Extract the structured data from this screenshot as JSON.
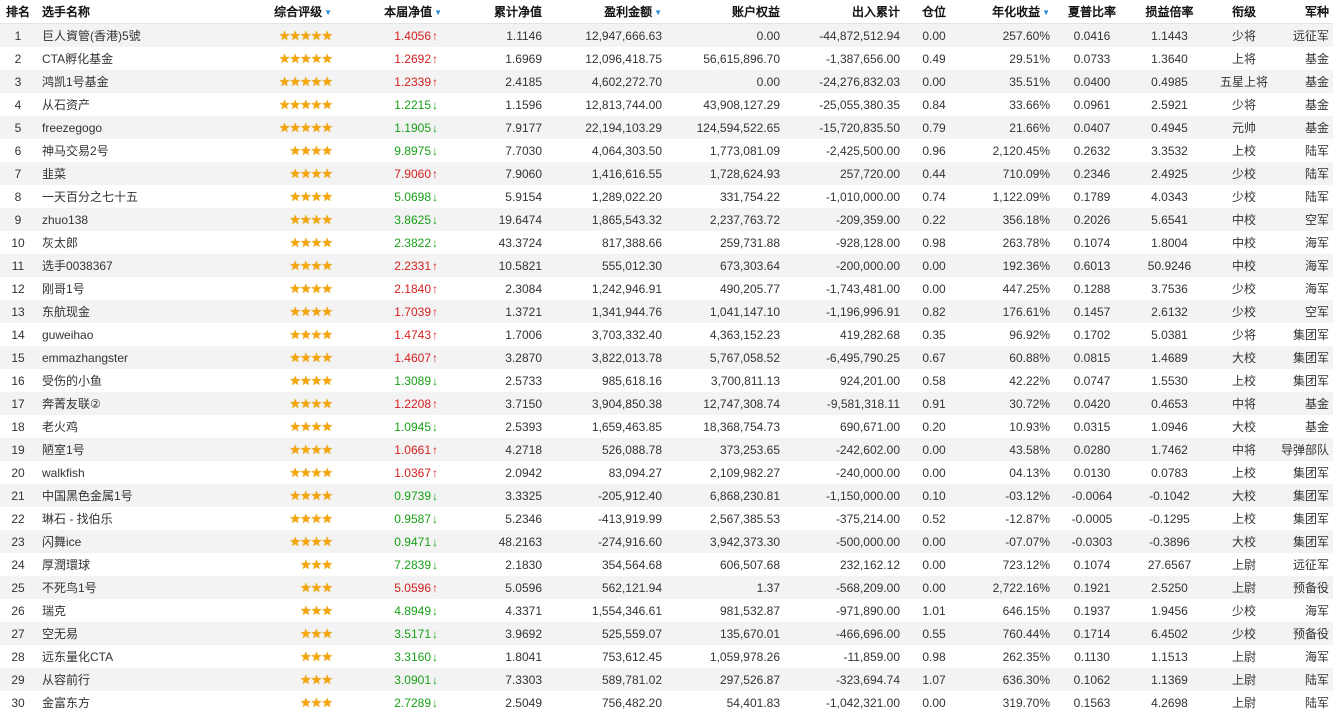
{
  "columns": {
    "rank": "排名",
    "name": "选手名称",
    "rating": "综合评级",
    "nav": "本届净值",
    "cum_nav": "累计净值",
    "profit": "盈利金额",
    "equity": "账户权益",
    "flow": "出入累计",
    "position": "仓位",
    "annual": "年化收益",
    "sharpe": "夏普比率",
    "pl_ratio": "损益倍率",
    "title": "衔级",
    "branch": "军种"
  },
  "sort_indicator": "▼",
  "rows": [
    {
      "rank": "1",
      "name": "巨人資管(香港)5號",
      "stars": "★★★★★",
      "nav": "1.4056",
      "trend": "up",
      "cum_nav": "1.1146",
      "profit": "12,947,666.63",
      "equity": "0.00",
      "flow": "-44,872,512.94",
      "position": "0.00",
      "annual": "257.60%",
      "sharpe": "0.0416",
      "pl_ratio": "1.1443",
      "title": "少将",
      "branch": "远征军"
    },
    {
      "rank": "2",
      "name": "CTA孵化基金",
      "stars": "★★★★★",
      "nav": "1.2692",
      "trend": "up",
      "cum_nav": "1.6969",
      "profit": "12,096,418.75",
      "equity": "56,615,896.70",
      "flow": "-1,387,656.00",
      "position": "0.49",
      "annual": "29.51%",
      "sharpe": "0.0733",
      "pl_ratio": "1.3640",
      "title": "上将",
      "branch": "基金"
    },
    {
      "rank": "3",
      "name": "鸿凯1号基金",
      "stars": "★★★★★",
      "nav": "1.2339",
      "trend": "up",
      "cum_nav": "2.4185",
      "profit": "4,602,272.70",
      "equity": "0.00",
      "flow": "-24,276,832.03",
      "position": "0.00",
      "annual": "35.51%",
      "sharpe": "0.0400",
      "pl_ratio": "0.4985",
      "title": "五星上将",
      "branch": "基金"
    },
    {
      "rank": "4",
      "name": "从石资产",
      "stars": "★★★★★",
      "nav": "1.2215",
      "trend": "down",
      "cum_nav": "1.1596",
      "profit": "12,813,744.00",
      "equity": "43,908,127.29",
      "flow": "-25,055,380.35",
      "position": "0.84",
      "annual": "33.66%",
      "sharpe": "0.0961",
      "pl_ratio": "2.5921",
      "title": "少将",
      "branch": "基金"
    },
    {
      "rank": "5",
      "name": "freezegogo",
      "stars": "★★★★★",
      "nav": "1.1905",
      "trend": "down",
      "cum_nav": "7.9177",
      "profit": "22,194,103.29",
      "equity": "124,594,522.65",
      "flow": "-15,720,835.50",
      "position": "0.79",
      "annual": "21.66%",
      "sharpe": "0.0407",
      "pl_ratio": "0.4945",
      "title": "元帅",
      "branch": "基金"
    },
    {
      "rank": "6",
      "name": "神马交易2号",
      "stars": "★★★★",
      "nav": "9.8975",
      "trend": "down",
      "cum_nav": "7.7030",
      "profit": "4,064,303.50",
      "equity": "1,773,081.09",
      "flow": "-2,425,500.00",
      "position": "0.96",
      "annual": "2,120.45%",
      "sharpe": "0.2632",
      "pl_ratio": "3.3532",
      "title": "上校",
      "branch": "陆军"
    },
    {
      "rank": "7",
      "name": "韭菜",
      "stars": "★★★★",
      "nav": "7.9060",
      "trend": "up",
      "cum_nav": "7.9060",
      "profit": "1,416,616.55",
      "equity": "1,728,624.93",
      "flow": "257,720.00",
      "position": "0.44",
      "annual": "710.09%",
      "sharpe": "0.2346",
      "pl_ratio": "2.4925",
      "title": "少校",
      "branch": "陆军"
    },
    {
      "rank": "8",
      "name": "一天百分之七十五",
      "stars": "★★★★",
      "nav": "5.0698",
      "trend": "down",
      "cum_nav": "5.9154",
      "profit": "1,289,022.20",
      "equity": "331,754.22",
      "flow": "-1,010,000.00",
      "position": "0.74",
      "annual": "1,122.09%",
      "sharpe": "0.1789",
      "pl_ratio": "4.0343",
      "title": "少校",
      "branch": "陆军"
    },
    {
      "rank": "9",
      "name": "zhuo138",
      "stars": "★★★★",
      "nav": "3.8625",
      "trend": "down",
      "cum_nav": "19.6474",
      "profit": "1,865,543.32",
      "equity": "2,237,763.72",
      "flow": "-209,359.00",
      "position": "0.22",
      "annual": "356.18%",
      "sharpe": "0.2026",
      "pl_ratio": "5.6541",
      "title": "中校",
      "branch": "空军"
    },
    {
      "rank": "10",
      "name": "灰太郎",
      "stars": "★★★★",
      "nav": "2.3822",
      "trend": "down",
      "cum_nav": "43.3724",
      "profit": "817,388.66",
      "equity": "259,731.88",
      "flow": "-928,128.00",
      "position": "0.98",
      "annual": "263.78%",
      "sharpe": "0.1074",
      "pl_ratio": "1.8004",
      "title": "中校",
      "branch": "海军"
    },
    {
      "rank": "11",
      "name": "选手0038367",
      "stars": "★★★★",
      "nav": "2.2331",
      "trend": "up",
      "cum_nav": "10.5821",
      "profit": "555,012.30",
      "equity": "673,303.64",
      "flow": "-200,000.00",
      "position": "0.00",
      "annual": "192.36%",
      "sharpe": "0.6013",
      "pl_ratio": "50.9246",
      "title": "中校",
      "branch": "海军"
    },
    {
      "rank": "12",
      "name": "刚哥1号",
      "stars": "★★★★",
      "nav": "2.1840",
      "trend": "up",
      "cum_nav": "2.3084",
      "profit": "1,242,946.91",
      "equity": "490,205.77",
      "flow": "-1,743,481.00",
      "position": "0.00",
      "annual": "447.25%",
      "sharpe": "0.1288",
      "pl_ratio": "3.7536",
      "title": "少校",
      "branch": "海军"
    },
    {
      "rank": "13",
      "name": "东航现金",
      "stars": "★★★★",
      "nav": "1.7039",
      "trend": "up",
      "cum_nav": "1.3721",
      "profit": "1,341,944.76",
      "equity": "1,041,147.10",
      "flow": "-1,196,996.91",
      "position": "0.82",
      "annual": "176.61%",
      "sharpe": "0.1457",
      "pl_ratio": "2.6132",
      "title": "少校",
      "branch": "空军"
    },
    {
      "rank": "14",
      "name": "guweihao",
      "stars": "★★★★",
      "nav": "1.4743",
      "trend": "up",
      "cum_nav": "1.7006",
      "profit": "3,703,332.40",
      "equity": "4,363,152.23",
      "flow": "419,282.68",
      "position": "0.35",
      "annual": "96.92%",
      "sharpe": "0.1702",
      "pl_ratio": "5.0381",
      "title": "少将",
      "branch": "集团军"
    },
    {
      "rank": "15",
      "name": "emmazhangster",
      "stars": "★★★★",
      "nav": "1.4607",
      "trend": "up",
      "cum_nav": "3.2870",
      "profit": "3,822,013.78",
      "equity": "5,767,058.52",
      "flow": "-6,495,790.25",
      "position": "0.67",
      "annual": "60.88%",
      "sharpe": "0.0815",
      "pl_ratio": "1.4689",
      "title": "大校",
      "branch": "集团军"
    },
    {
      "rank": "16",
      "name": "受伤的小鱼",
      "stars": "★★★★",
      "nav": "1.3089",
      "trend": "down",
      "cum_nav": "2.5733",
      "profit": "985,618.16",
      "equity": "3,700,811.13",
      "flow": "924,201.00",
      "position": "0.58",
      "annual": "42.22%",
      "sharpe": "0.0747",
      "pl_ratio": "1.5530",
      "title": "上校",
      "branch": "集团军"
    },
    {
      "rank": "17",
      "name": "奔菁友联②",
      "stars": "★★★★",
      "nav": "1.2208",
      "trend": "up",
      "cum_nav": "3.7150",
      "profit": "3,904,850.38",
      "equity": "12,747,308.74",
      "flow": "-9,581,318.11",
      "position": "0.91",
      "annual": "30.72%",
      "sharpe": "0.0420",
      "pl_ratio": "0.4653",
      "title": "中将",
      "branch": "基金"
    },
    {
      "rank": "18",
      "name": "老火鸡",
      "stars": "★★★★",
      "nav": "1.0945",
      "trend": "down",
      "cum_nav": "2.5393",
      "profit": "1,659,463.85",
      "equity": "18,368,754.73",
      "flow": "690,671.00",
      "position": "0.20",
      "annual": "10.93%",
      "sharpe": "0.0315",
      "pl_ratio": "1.0946",
      "title": "大校",
      "branch": "基金"
    },
    {
      "rank": "19",
      "name": "陋室1号",
      "stars": "★★★★",
      "nav": "1.0661",
      "trend": "up",
      "cum_nav": "4.2718",
      "profit": "526,088.78",
      "equity": "373,253.65",
      "flow": "-242,602.00",
      "position": "0.00",
      "annual": "43.58%",
      "sharpe": "0.0280",
      "pl_ratio": "1.7462",
      "title": "中将",
      "branch": "导弹部队"
    },
    {
      "rank": "20",
      "name": "walkfish",
      "stars": "★★★★",
      "nav": "1.0367",
      "trend": "up",
      "cum_nav": "2.0942",
      "profit": "83,094.27",
      "equity": "2,109,982.27",
      "flow": "-240,000.00",
      "position": "0.00",
      "annual": "04.13%",
      "sharpe": "0.0130",
      "pl_ratio": "0.0783",
      "title": "上校",
      "branch": "集团军"
    },
    {
      "rank": "21",
      "name": "中国黑色金属1号",
      "stars": "★★★★",
      "nav": "0.9739",
      "trend": "down",
      "cum_nav": "3.3325",
      "profit": "-205,912.40",
      "equity": "6,868,230.81",
      "flow": "-1,150,000.00",
      "position": "0.10",
      "annual": "-03.12%",
      "sharpe": "-0.0064",
      "pl_ratio": "-0.1042",
      "title": "大校",
      "branch": "集团军"
    },
    {
      "rank": "22",
      "name": "琳石 - 找伯乐",
      "stars": "★★★★",
      "nav": "0.9587",
      "trend": "down",
      "cum_nav": "5.2346",
      "profit": "-413,919.99",
      "equity": "2,567,385.53",
      "flow": "-375,214.00",
      "position": "0.52",
      "annual": "-12.87%",
      "sharpe": "-0.0005",
      "pl_ratio": "-0.1295",
      "title": "上校",
      "branch": "集团军"
    },
    {
      "rank": "23",
      "name": "闪舞ice",
      "stars": "★★★★",
      "nav": "0.9471",
      "trend": "down",
      "cum_nav": "48.2163",
      "profit": "-274,916.60",
      "equity": "3,942,373.30",
      "flow": "-500,000.00",
      "position": "0.00",
      "annual": "-07.07%",
      "sharpe": "-0.0303",
      "pl_ratio": "-0.3896",
      "title": "大校",
      "branch": "集团军"
    },
    {
      "rank": "24",
      "name": "厚潤環球",
      "stars": "★★★",
      "nav": "7.2839",
      "trend": "down",
      "cum_nav": "2.1830",
      "profit": "354,564.68",
      "equity": "606,507.68",
      "flow": "232,162.12",
      "position": "0.00",
      "annual": "723.12%",
      "sharpe": "0.1074",
      "pl_ratio": "27.6567",
      "title": "上尉",
      "branch": "远征军"
    },
    {
      "rank": "25",
      "name": "不死鸟1号",
      "stars": "★★★",
      "nav": "5.0596",
      "trend": "up",
      "cum_nav": "5.0596",
      "profit": "562,121.94",
      "equity": "1.37",
      "flow": "-568,209.00",
      "position": "0.00",
      "annual": "2,722.16%",
      "sharpe": "0.1921",
      "pl_ratio": "2.5250",
      "title": "上尉",
      "branch": "预备役"
    },
    {
      "rank": "26",
      "name": "瑞克",
      "stars": "★★★",
      "nav": "4.8949",
      "trend": "down",
      "cum_nav": "4.3371",
      "profit": "1,554,346.61",
      "equity": "981,532.87",
      "flow": "-971,890.00",
      "position": "1.01",
      "annual": "646.15%",
      "sharpe": "0.1937",
      "pl_ratio": "1.9456",
      "title": "少校",
      "branch": "海军"
    },
    {
      "rank": "27",
      "name": "空无易",
      "stars": "★★★",
      "nav": "3.5171",
      "trend": "down",
      "cum_nav": "3.9692",
      "profit": "525,559.07",
      "equity": "135,670.01",
      "flow": "-466,696.00",
      "position": "0.55",
      "annual": "760.44%",
      "sharpe": "0.1714",
      "pl_ratio": "6.4502",
      "title": "少校",
      "branch": "预备役"
    },
    {
      "rank": "28",
      "name": "远东量化CTA",
      "stars": "★★★",
      "nav": "3.3160",
      "trend": "down",
      "cum_nav": "1.8041",
      "profit": "753,612.45",
      "equity": "1,059,978.26",
      "flow": "-11,859.00",
      "position": "0.98",
      "annual": "262.35%",
      "sharpe": "0.1130",
      "pl_ratio": "1.1513",
      "title": "上尉",
      "branch": "海军"
    },
    {
      "rank": "29",
      "name": "从容前行",
      "stars": "★★★",
      "nav": "3.0901",
      "trend": "down",
      "cum_nav": "7.3303",
      "profit": "589,781.02",
      "equity": "297,526.87",
      "flow": "-323,694.74",
      "position": "1.07",
      "annual": "636.30%",
      "sharpe": "0.1062",
      "pl_ratio": "1.1369",
      "title": "上尉",
      "branch": "陆军"
    },
    {
      "rank": "30",
      "name": "金富东方",
      "stars": "★★★",
      "nav": "2.7289",
      "trend": "down",
      "cum_nav": "2.5049",
      "profit": "756,482.20",
      "equity": "54,401.83",
      "flow": "-1,042,321.00",
      "position": "0.00",
      "annual": "319.70%",
      "sharpe": "0.1563",
      "pl_ratio": "4.2698",
      "title": "上尉",
      "branch": "陆军"
    }
  ]
}
